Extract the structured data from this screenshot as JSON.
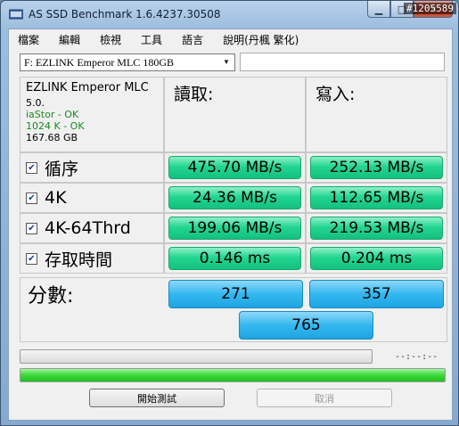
{
  "window": {
    "title": "AS SSD Benchmark 1.6.4237.30508",
    "watermark": "#1205589"
  },
  "menu": [
    "檔案",
    "編輯",
    "檢視",
    "工具",
    "語言",
    "說明(丹楓 繁化)"
  ],
  "drive": {
    "selected": "F: EZLINK Emperor MLC 180GB"
  },
  "info": {
    "model": "EZLINK Emperor MLC",
    "firmware": "5.0.",
    "driver": "iaStor - OK",
    "alignment": "1024 K - OK",
    "size": "167.68 GB"
  },
  "headers": {
    "read": "讀取:",
    "write": "寫入:"
  },
  "rows": [
    {
      "label": "循序",
      "checked": true,
      "read": "475.70 MB/s",
      "write": "252.13 MB/s"
    },
    {
      "label": "4K",
      "checked": true,
      "read": "24.36 MB/s",
      "write": "112.65 MB/s"
    },
    {
      "label": "4K-64Thrd",
      "checked": true,
      "read": "199.06 MB/s",
      "write": "219.53 MB/s"
    },
    {
      "label": "存取時間",
      "checked": true,
      "read": "0.146 ms",
      "write": "0.204 ms"
    }
  ],
  "score": {
    "label": "分數:",
    "read": "271",
    "write": "357",
    "total": "765"
  },
  "progress": {
    "time": "--:--:--",
    "overall_fraction": 1.0
  },
  "buttons": {
    "start": "開始測試",
    "cancel": "取消"
  },
  "colors": {
    "result_green": "#22d690",
    "score_blue": "#33b7ef",
    "ok_text": "#1c8a24"
  }
}
